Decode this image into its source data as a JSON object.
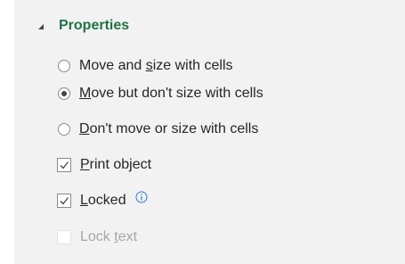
{
  "properties": {
    "title": "Properties",
    "collapse_icon": "triangle-down-icon",
    "accent_color": "#217346",
    "options": {
      "move_and_size": {
        "before": "Move and ",
        "key": "s",
        "after": "ize with cells",
        "checked": false
      },
      "move_no_size": {
        "before": "",
        "key": "M",
        "after": "ove but don't size with cells",
        "checked": true
      },
      "no_move_no_size": {
        "before": "",
        "key": "D",
        "after": "on't move or size with cells",
        "checked": false
      }
    },
    "checkboxes": {
      "print_object": {
        "before": "",
        "key": "P",
        "after": "rint object",
        "checked": true,
        "disabled": false
      },
      "locked": {
        "before": "",
        "key": "L",
        "after": "ocked",
        "checked": true,
        "disabled": false,
        "info_icon": "info-icon"
      },
      "lock_text": {
        "before": "Lock ",
        "key": "t",
        "after": "ext",
        "checked": false,
        "disabled": true
      }
    }
  }
}
